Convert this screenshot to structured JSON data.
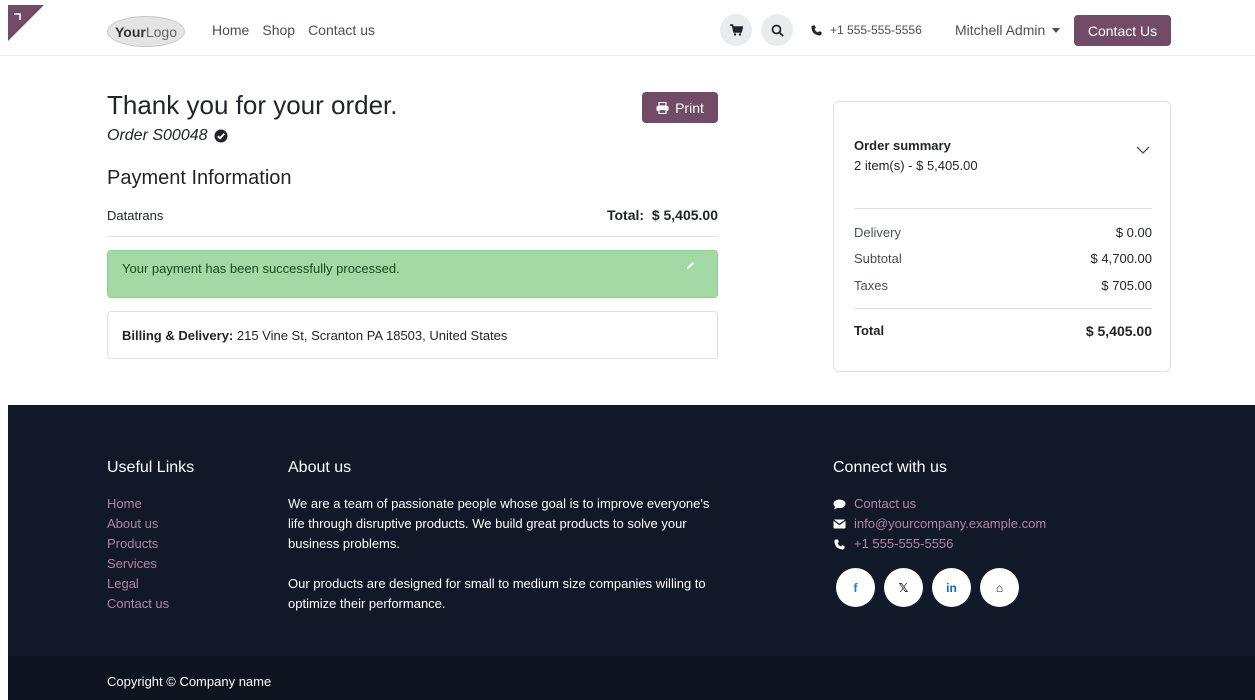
{
  "header": {
    "logo_bold": "Your",
    "logo_light": "Logo",
    "nav": [
      "Home",
      "Shop",
      "Contact us"
    ],
    "phone": "+1 555-555-5556",
    "user": "Mitchell Admin",
    "contact_button": "Contact Us",
    "brand_color": "#714b67"
  },
  "main": {
    "title": "Thank you for your order.",
    "order_ref": "Order S00048",
    "print_label": "Print",
    "payment_title": "Payment Information",
    "payment_method": "Datatrans",
    "total_label": "Total:",
    "total_value": "$ 5,405.00",
    "alert_message": "Your payment has been successfully processed.",
    "billing_label": "Billing & Delivery:",
    "billing_address": " 215 Vine St, Scranton PA 18503, United States"
  },
  "summary": {
    "title": "Order summary",
    "items": "2 item(s) -  $ 5,405.00",
    "delivery_label": "Delivery",
    "delivery_value": "$ 0.00",
    "subtotal_label": "Subtotal",
    "subtotal_value": "$ 4,700.00",
    "taxes_label": "Taxes",
    "taxes_value": "$ 705.00",
    "total_label": "Total",
    "total_value": "$ 5,405.00"
  },
  "footer": {
    "useful_links_title": "Useful Links",
    "useful_links": [
      "Home",
      "About us",
      "Products",
      "Services",
      "Legal",
      "Contact us"
    ],
    "about_title": "About us",
    "about_p1": "We are a team of passionate people whose goal is to improve everyone's life through disruptive products. We build great products to solve your business problems.",
    "about_p2": "Our products are designed for small to medium size companies willing to optimize their performance.",
    "connect_title": "Connect with us",
    "connect_contact": "Contact us",
    "connect_email": "info@yourcompany.example.com",
    "connect_phone": "+1 555-555-5556",
    "socials": [
      "f",
      "𝕏",
      "in",
      "⌂"
    ],
    "copyright": "Copyright © Company name"
  }
}
